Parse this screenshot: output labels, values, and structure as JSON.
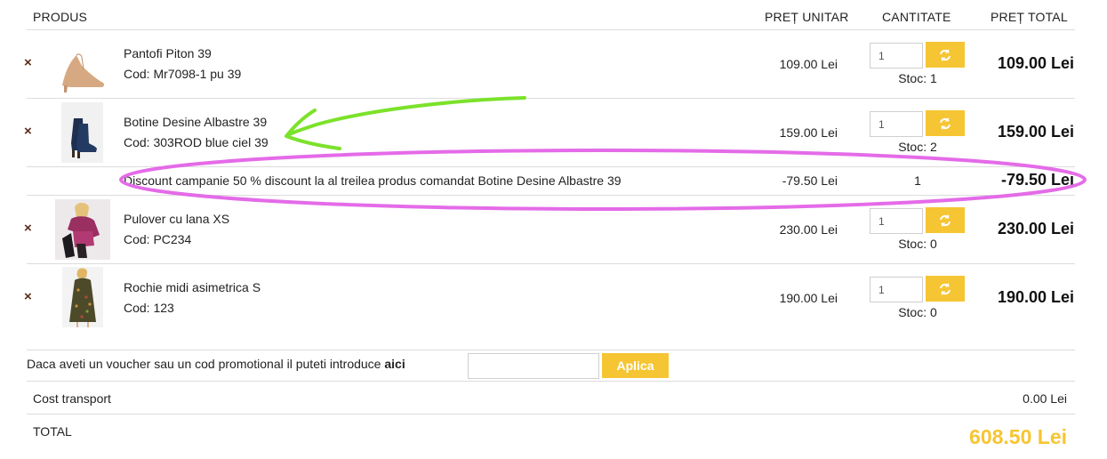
{
  "table": {
    "headers": {
      "product": "PRODUS",
      "unit_price": "PREȚ UNITAR",
      "quantity": "CANTITATE",
      "total_price": "PREȚ TOTAL"
    },
    "remove_symbol": "×",
    "items": [
      {
        "name": "Pantofi Piton 39",
        "code": "Cod: Mr7098-1 pu 39",
        "unit_price": "109.00 Lei",
        "qty": "1",
        "stock": "Stoc: 1",
        "total": "109.00 Lei",
        "image_icon": "nude-stiletto-pump-icon"
      },
      {
        "name": "Botine Desine Albastre 39",
        "code": "Cod: 303ROD blue ciel 39",
        "unit_price": "159.00 Lei",
        "qty": "1",
        "stock": "Stoc: 2",
        "total": "159.00 Lei",
        "image_icon": "navy-ankle-boots-icon"
      },
      {
        "name": "Pulover cu lana XS",
        "code": "Cod: PC234",
        "unit_price": "230.00 Lei",
        "qty": "1",
        "stock": "Stoc: 0",
        "total": "230.00 Lei",
        "image_icon": "model-in-sweater-icon"
      },
      {
        "name": "Rochie midi asimetrica S",
        "code": "Cod: 123",
        "unit_price": "190.00 Lei",
        "qty": "1",
        "stock": "Stoc: 0",
        "total": "190.00 Lei",
        "image_icon": "model-in-floral-dress-icon"
      }
    ],
    "discount": {
      "label": "Discount campanie 50 % discount la al treilea produs comandat Botine Desine Albastre 39",
      "unit_price": "-79.50 Lei",
      "qty": "1",
      "total": "-79.50 Lei"
    }
  },
  "voucher": {
    "text": "Daca aveti un voucher sau un cod promotional il puteti introduce ",
    "text_bold": "aici",
    "input_value": "",
    "apply_label": "Aplica"
  },
  "summary": {
    "shipping_label": "Cost transport",
    "shipping_value": "0.00 Lei",
    "total_label": "TOTAL",
    "total_value": "608.50 Lei"
  },
  "annotations": {
    "arrow_color": "#7be22a",
    "ellipse_color": "#e46be8"
  },
  "colors": {
    "accent": "#f6c533",
    "remove": "#5a2a18"
  }
}
